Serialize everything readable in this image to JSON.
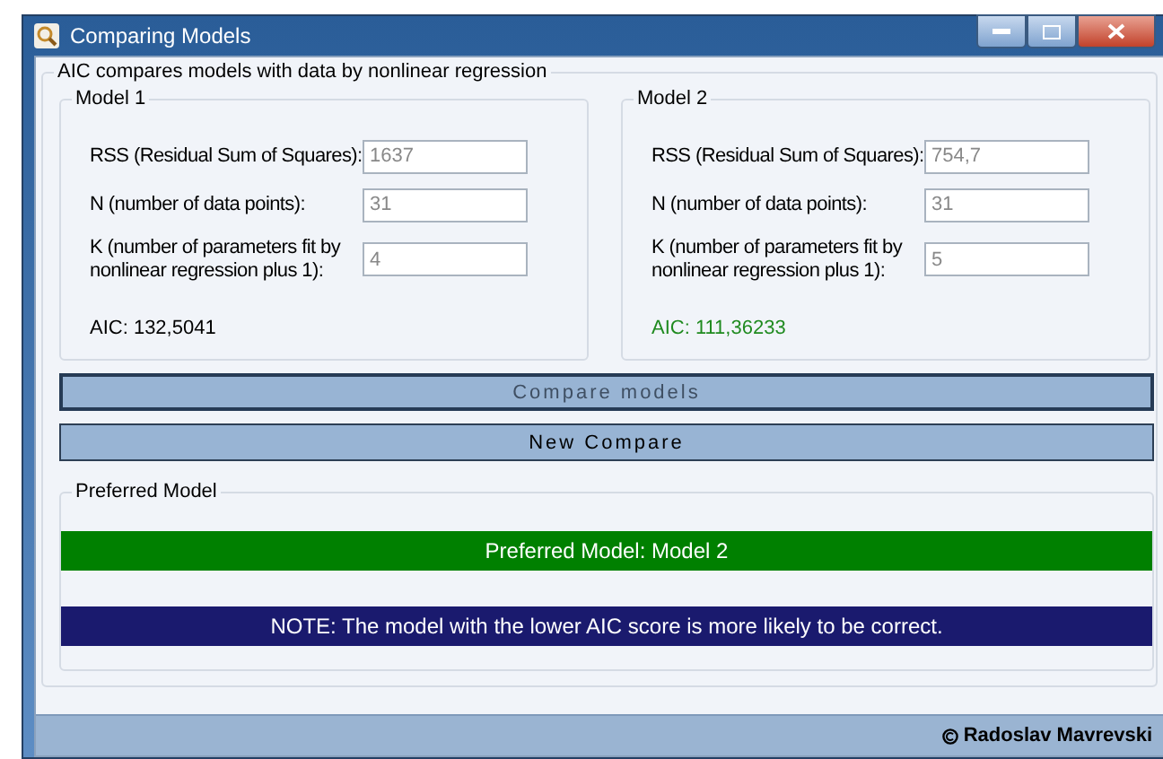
{
  "window": {
    "title": "Comparing Models"
  },
  "main_group": {
    "title": "AIC compares models with data by nonlinear regression"
  },
  "models": [
    {
      "title": "Model 1",
      "fields": [
        {
          "label": "RSS (Residual Sum of Squares):",
          "value": "1637"
        },
        {
          "label": "N (number of data points):",
          "value": "31"
        },
        {
          "label": "K (number of parameters fit by nonlinear regression plus 1):",
          "value": "4"
        }
      ],
      "aic": "AIC: 132,5041",
      "preferred": false
    },
    {
      "title": "Model 2",
      "fields": [
        {
          "label": "RSS (Residual Sum of Squares):",
          "value": "754,7"
        },
        {
          "label": "N (number of data points):",
          "value": "31"
        },
        {
          "label": "K (number of parameters fit by nonlinear regression plus 1):",
          "value": "5"
        }
      ],
      "aic": "AIC: 111,36233",
      "preferred": true
    }
  ],
  "buttons": [
    {
      "label": "Compare models",
      "focused": true
    },
    {
      "label": "New Compare",
      "focused": false
    }
  ],
  "result_group": {
    "title": "Preferred Model",
    "result": "Preferred Model: Model 2",
    "note": "NOTE: The model with the lower AIC score is more likely to be correct."
  },
  "status_bar": {
    "author": "Radoslav Mavrevski"
  }
}
